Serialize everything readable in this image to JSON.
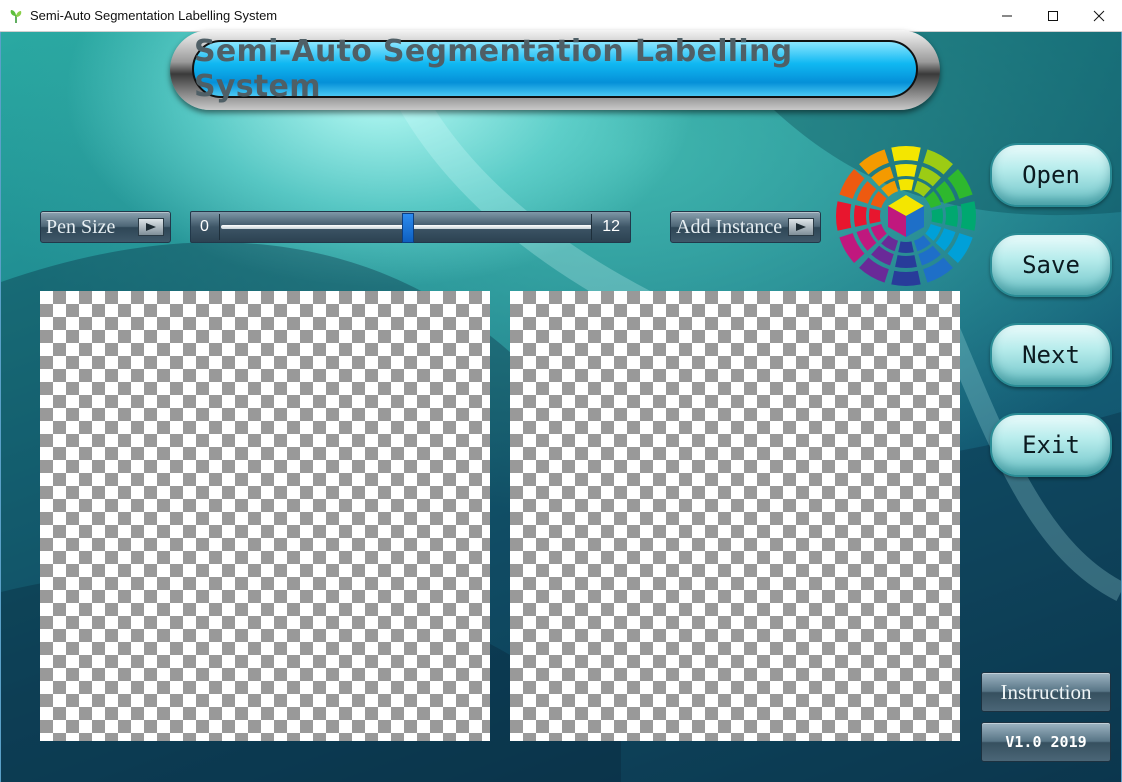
{
  "window": {
    "title": "Semi-Auto Segmentation Labelling System",
    "app_icon": "leaf-icon",
    "controls": [
      "minimize-icon",
      "maximize-icon",
      "close-icon"
    ]
  },
  "header": {
    "title": "Semi-Auto Segmentation Labelling System"
  },
  "toolbar": {
    "pen_size_label": "Pen Size",
    "add_instance_label": "Add Instance",
    "pen_size_slider": {
      "min_label": "0",
      "max_label": "12",
      "value": 6
    }
  },
  "side_buttons": {
    "open": "Open",
    "save": "Save",
    "next": "Next",
    "exit": "Exit"
  },
  "footer": {
    "instruction_label": "Instruction",
    "version_label": "V1.0 2019"
  },
  "colors": {
    "accent": "#10b8f2",
    "slider_thumb": "#1a78e0",
    "wheel": [
      "#f4e600",
      "#9ccc14",
      "#2eb82e",
      "#00a870",
      "#00a0d8",
      "#1e6fc8",
      "#283c9a",
      "#6a2a98",
      "#c0187e",
      "#e8162e",
      "#ee5a10",
      "#f49a00"
    ]
  },
  "icons": {
    "pen_size_arrow": "play-icon",
    "add_instance_arrow": "play-icon",
    "color_picker": "color-wheel-icon"
  }
}
